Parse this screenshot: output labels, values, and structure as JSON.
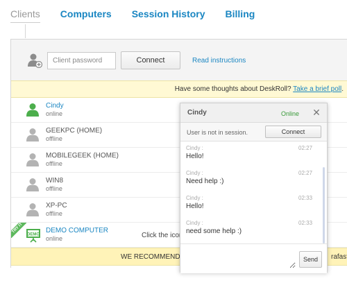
{
  "tabs": [
    {
      "label": "Clients",
      "active": true
    },
    {
      "label": "Computers",
      "active": false
    },
    {
      "label": "Session History",
      "active": false
    },
    {
      "label": "Billing",
      "active": false
    }
  ],
  "connect": {
    "password_placeholder": "Client password",
    "password_value": "",
    "connect_label": "Connect",
    "instructions_label": "Read instructions"
  },
  "feedback": {
    "text": "Have some thoughts about DeskRoll? ",
    "link": "Take a brief poll",
    "suffix": "."
  },
  "computers": [
    {
      "name": "Cindy",
      "status": "online",
      "online": true
    },
    {
      "name": "GEEKPC (HOME)",
      "status": "offline",
      "online": false
    },
    {
      "name": "MOBILEGEEK (HOME)",
      "status": "offline",
      "online": false
    },
    {
      "name": "WIN8",
      "status": "offline",
      "online": false
    },
    {
      "name": "XP-PC",
      "status": "offline",
      "online": false
    }
  ],
  "demo": {
    "badge": "TRY IT",
    "name": "DEMO COMPUTER",
    "status": "online",
    "hint": "Click the icon"
  },
  "recommend": {
    "left": "WE RECOMMEND",
    "right": "rafast"
  },
  "chat": {
    "title": "Cindy",
    "presence": "Online",
    "session_text": "User is not in session.",
    "connect_label": "Connect",
    "send_label": "Send",
    "input_value": "",
    "messages": [
      {
        "sender": "Cindy :",
        "time": "02:27",
        "text": "Hello!"
      },
      {
        "sender": "Cindy :",
        "time": "02:27",
        "text": "Need help :)"
      },
      {
        "sender": "Cindy :",
        "time": "02:33",
        "text": "Hello!"
      },
      {
        "sender": "Cindy :",
        "time": "02:33",
        "text": "need some help :)"
      }
    ]
  },
  "colors": {
    "link": "#1a86c2",
    "online_icon": "#4cae4c",
    "offline_icon": "#b3b3b3",
    "feedback_bg": "#fff9d4",
    "recommend_bg": "#fff3b8"
  }
}
